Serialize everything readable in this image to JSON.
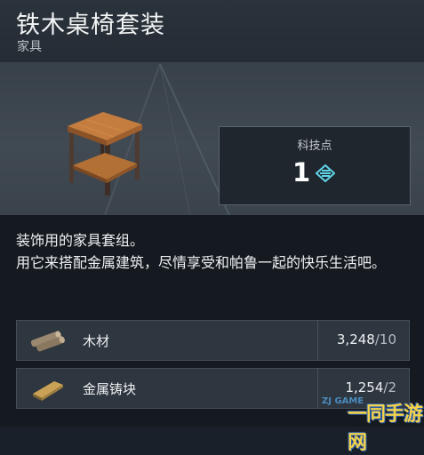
{
  "item": {
    "title": "铁木桌椅套装",
    "category": "家具",
    "icon": "table-with-shelf",
    "tech_label": "科技点",
    "tech_value": "1",
    "tech_icon": "tech-point-icon",
    "description": "装饰用的家具套组。\n用它来搭配金属建筑，尽情享受和帕鲁一起的快乐生活吧。"
  },
  "materials": [
    {
      "name": "木材",
      "icon": "wood-log-icon",
      "owned": "3,248",
      "required": "10"
    },
    {
      "name": "金属铸块",
      "icon": "metal-ingot-icon",
      "owned": "1,254",
      "required": "2"
    }
  ],
  "watermark": {
    "text": "一同手游网",
    "sub": "ZJ GAME"
  },
  "colors": {
    "accent": "#5fd3e6",
    "panel": "#2e363f",
    "background": "#151a21"
  }
}
